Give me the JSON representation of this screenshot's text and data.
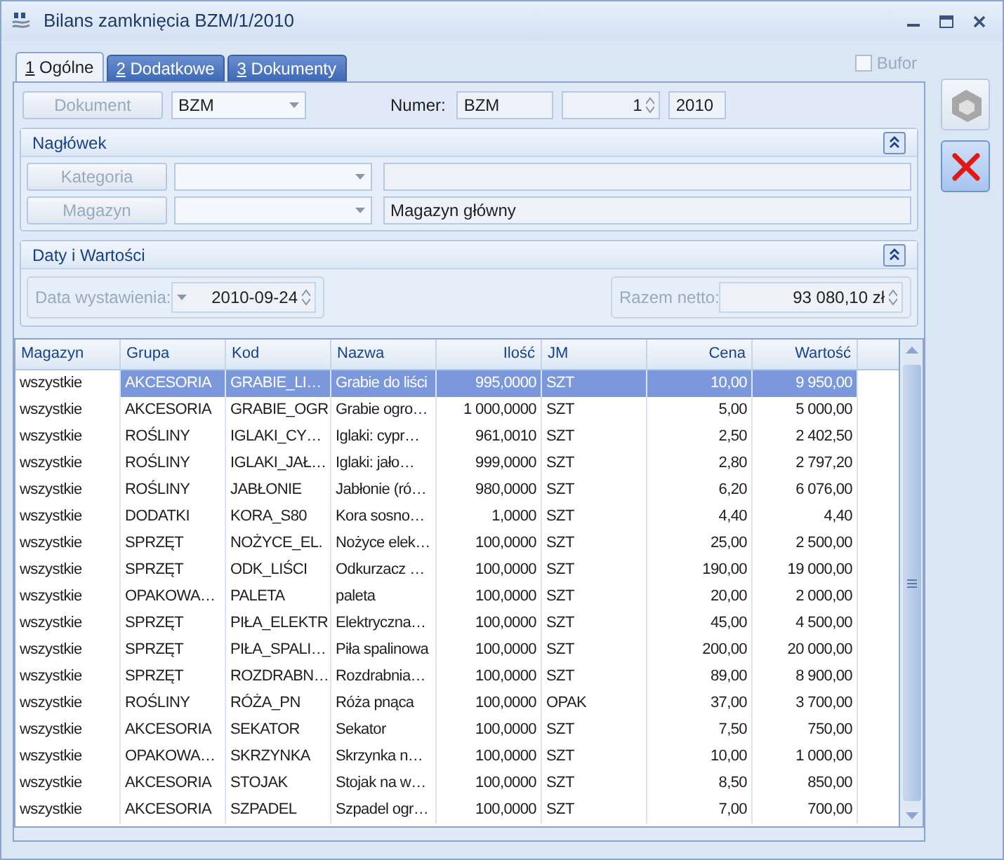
{
  "window": {
    "title": "Bilans zamknięcia BZM/1/2010"
  },
  "tabs": [
    {
      "hotkey": "1",
      "label": " Ogólne",
      "selected": true
    },
    {
      "hotkey": "2",
      "label": " Dodatkowe",
      "selected": false
    },
    {
      "hotkey": "3",
      "label": " Dokumenty",
      "selected": false
    }
  ],
  "bufor": {
    "label": "Bufor",
    "checked": false
  },
  "document": {
    "button": {
      "label": "Dokument",
      "disabled": true
    },
    "type": "BZM",
    "number_label": "Numer:",
    "number_prefix": "BZM",
    "number": "1",
    "year": "2010"
  },
  "header_section": {
    "title": "Nagłówek",
    "expanded": true,
    "rows": [
      {
        "button": {
          "label": "Kategoria",
          "disabled": true
        },
        "value": ""
      },
      {
        "button": {
          "label": "Magazyn",
          "disabled": true
        },
        "value": "Magazyn główny"
      }
    ]
  },
  "dates_section": {
    "title": "Daty i Wartości",
    "expanded": true,
    "date_label": "Data wystawienia:",
    "date": "2010-09-24",
    "total_label": "Razem netto:",
    "total": "93 080,10 zł"
  },
  "table": {
    "columns": [
      "Magazyn",
      "Grupa",
      "Kod",
      "Nazwa",
      "Ilość",
      "JM",
      "Cena",
      "Wartość"
    ],
    "rows": [
      {
        "cells": [
          "wszystkie",
          "AKCESORIA",
          "GRABIE_LI…",
          "Grabie do liści",
          "995,0000",
          "SZT",
          "10,00",
          "9 950,00"
        ],
        "selected": true
      },
      {
        "cells": [
          "wszystkie",
          "AKCESORIA",
          "GRABIE_OGR",
          "Grabie ogro…",
          "1 000,0000",
          "SZT",
          "5,00",
          "5 000,00"
        ],
        "selected": false
      },
      {
        "cells": [
          "wszystkie",
          "ROŚLINY",
          "IGLAKI_CY…",
          "Iglaki: cypr…",
          "961,0010",
          "SZT",
          "2,50",
          "2 402,50"
        ],
        "selected": false
      },
      {
        "cells": [
          "wszystkie",
          "ROŚLINY",
          "IGLAKI_JAŁ…",
          "Iglaki: jało…",
          "999,0000",
          "SZT",
          "2,80",
          "2 797,20"
        ],
        "selected": false
      },
      {
        "cells": [
          "wszystkie",
          "ROŚLINY",
          "JABŁONIE",
          "Jabłonie (ró…",
          "980,0000",
          "SZT",
          "6,20",
          "6 076,00"
        ],
        "selected": false
      },
      {
        "cells": [
          "wszystkie",
          "DODATKI",
          "KORA_S80",
          "Kora sosno…",
          "1,0000",
          "SZT",
          "4,40",
          "4,40"
        ],
        "selected": false
      },
      {
        "cells": [
          "wszystkie",
          "SPRZĘT",
          "NOŻYCE_EL.",
          "Nożyce elek…",
          "100,0000",
          "SZT",
          "25,00",
          "2 500,00"
        ],
        "selected": false
      },
      {
        "cells": [
          "wszystkie",
          "SPRZĘT",
          "ODK_LIŚCI",
          "Odkurzacz …",
          "100,0000",
          "SZT",
          "190,00",
          "19 000,00"
        ],
        "selected": false
      },
      {
        "cells": [
          "wszystkie",
          "OPAKOWA…",
          "PALETA",
          "paleta",
          "100,0000",
          "SZT",
          "20,00",
          "2 000,00"
        ],
        "selected": false
      },
      {
        "cells": [
          "wszystkie",
          "SPRZĘT",
          "PIŁA_ELEKTR",
          "Elektryczna…",
          "100,0000",
          "SZT",
          "45,00",
          "4 500,00"
        ],
        "selected": false
      },
      {
        "cells": [
          "wszystkie",
          "SPRZĘT",
          "PIŁA_SPALI…",
          "Piła spalinowa",
          "100,0000",
          "SZT",
          "200,00",
          "20 000,00"
        ],
        "selected": false
      },
      {
        "cells": [
          "wszystkie",
          "SPRZĘT",
          "ROZDRABN…",
          "Rozdrabnia…",
          "100,0000",
          "SZT",
          "89,00",
          "8 900,00"
        ],
        "selected": false
      },
      {
        "cells": [
          "wszystkie",
          "ROŚLINY",
          "RÓŻA_PN",
          "Róża pnąca",
          "100,0000",
          "OPAK",
          "37,00",
          "3 700,00"
        ],
        "selected": false
      },
      {
        "cells": [
          "wszystkie",
          "AKCESORIA",
          "SEKATOR",
          "Sekator",
          "100,0000",
          "SZT",
          "7,50",
          "750,00"
        ],
        "selected": false
      },
      {
        "cells": [
          "wszystkie",
          "OPAKOWA…",
          "SKRZYNKA",
          "Skrzynka n…",
          "100,0000",
          "SZT",
          "10,00",
          "1 000,00"
        ],
        "selected": false
      },
      {
        "cells": [
          "wszystkie",
          "AKCESORIA",
          "STOJAK",
          "Stojak na w…",
          "100,0000",
          "SZT",
          "8,50",
          "850,00"
        ],
        "selected": false
      },
      {
        "cells": [
          "wszystkie",
          "AKCESORIA",
          "SZPADEL",
          "Szpadel ogr…",
          "100,0000",
          "SZT",
          "7,00",
          "700,00"
        ],
        "selected": false
      }
    ]
  }
}
